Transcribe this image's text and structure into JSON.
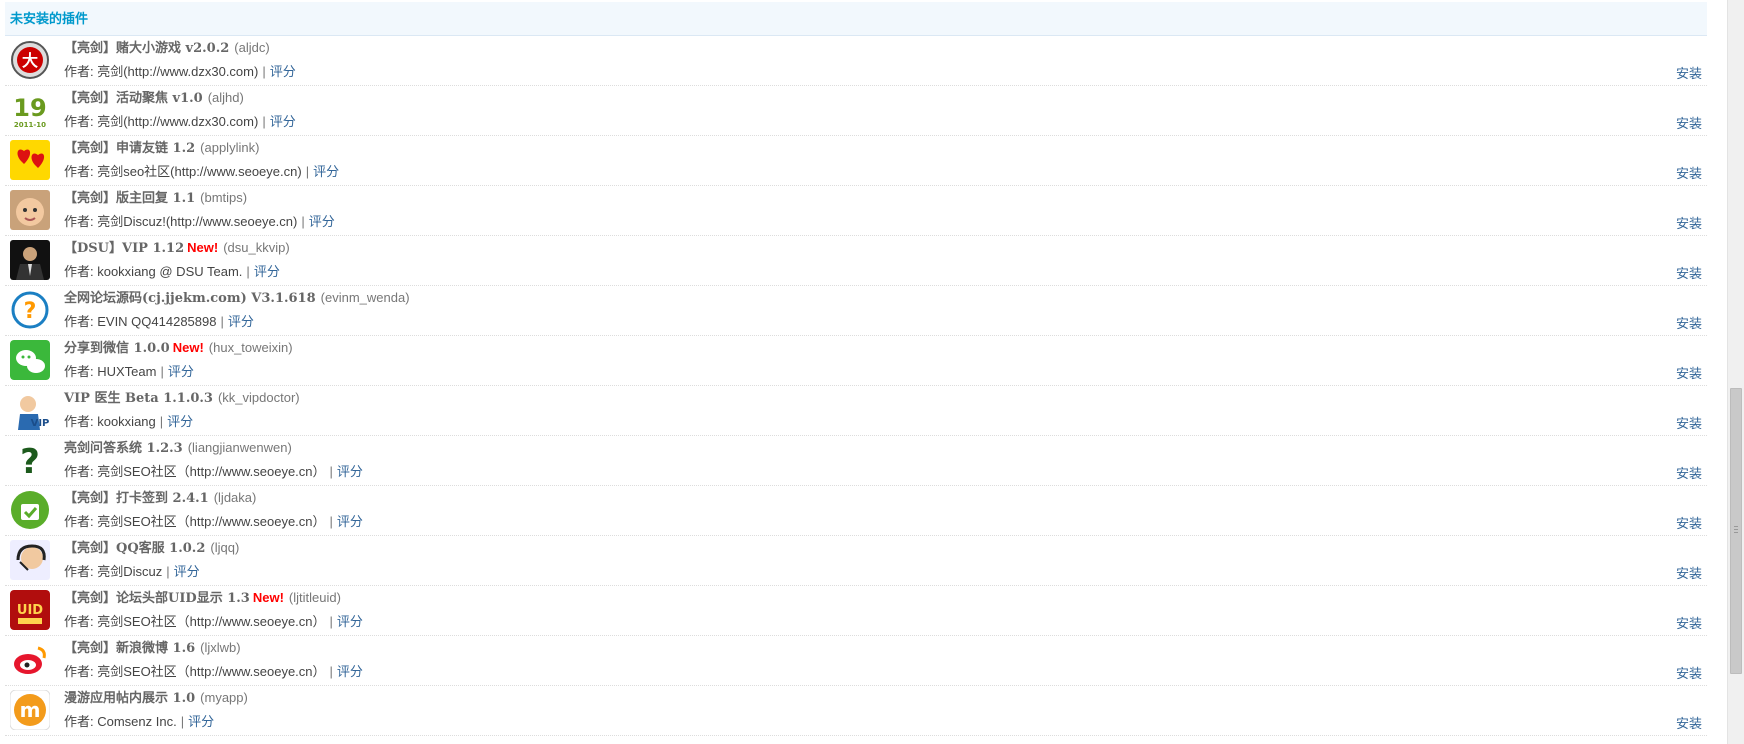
{
  "section": {
    "title": "未安装的插件"
  },
  "colors": {
    "link": "#336699",
    "header_text": "#0099cc",
    "new_badge": "#ff0000"
  },
  "plugins": [
    {
      "icon": "dice-da-icon",
      "name": "【亮剑】赌大小游戏 v2.0.2",
      "new": "",
      "id": "(aljdc)",
      "author": "作者: 亮剑(http://www.dzx30.com)",
      "rate": "评分",
      "install": "安装"
    },
    {
      "icon": "calendar-19-icon",
      "name": "【亮剑】活动聚焦 v1.0",
      "new": "",
      "id": "(aljhd)",
      "author": "作者: 亮剑(http://www.dzx30.com)",
      "rate": "评分",
      "install": "安装"
    },
    {
      "icon": "hearts-icon",
      "name": "【亮剑】申请友链 1.2",
      "new": "",
      "id": "(applylink)",
      "author": "作者: 亮剑seo社区(http://www.seoeye.cn)",
      "rate": "评分",
      "install": "安装"
    },
    {
      "icon": "baby-face-icon",
      "name": "【亮剑】版主回复 1.1",
      "new": "",
      "id": "(bmtips)",
      "author": "作者: 亮剑Discuz!(http://www.seoeye.cn)",
      "rate": "评分",
      "install": "安装"
    },
    {
      "icon": "businessman-icon",
      "name": "【DSU】VIP 1.12",
      "new": "New!",
      "id": "(dsu_kkvip)",
      "author": "作者: kookxiang @ DSU Team.",
      "rate": "评分",
      "install": "安装"
    },
    {
      "icon": "question-circle-icon",
      "name": "全网论坛源码(cj.jjekm.com) V3.1.618",
      "new": "",
      "id": "(evinm_wenda)",
      "author": "作者: EVIN QQ414285898",
      "rate": "评分",
      "install": "安装"
    },
    {
      "icon": "wechat-icon",
      "name": "分享到微信 1.0.0",
      "new": "New!",
      "id": "(hux_toweixin)",
      "author": "作者: HUXTeam",
      "rate": "评分",
      "install": "安装"
    },
    {
      "icon": "vip-doctor-icon",
      "name": "VIP 医生 Beta 1.1.0.3",
      "new": "",
      "id": "(kk_vipdoctor)",
      "author": "作者: kookxiang",
      "rate": "评分",
      "install": "安装"
    },
    {
      "icon": "question-mark-icon",
      "name": "亮剑问答系统 1.2.3",
      "new": "",
      "id": "(liangjianwenwen)",
      "author": "作者: 亮剑SEO社区（http://www.seoeye.cn）",
      "rate": "评分",
      "install": "安装"
    },
    {
      "icon": "checkin-bag-icon",
      "name": "【亮剑】打卡签到 2.4.1",
      "new": "",
      "id": "(ljdaka)",
      "author": "作者: 亮剑SEO社区（http://www.seoeye.cn）",
      "rate": "评分",
      "install": "安装"
    },
    {
      "icon": "headset-service-icon",
      "name": "【亮剑】QQ客服 1.0.2",
      "new": "",
      "id": "(ljqq)",
      "author": "作者: 亮剑Discuz",
      "rate": "评分",
      "install": "安装"
    },
    {
      "icon": "uid-badge-icon",
      "name": "【亮剑】论坛头部UID显示 1.3",
      "new": "New!",
      "id": "(ljtitleuid)",
      "author": "作者: 亮剑SEO社区（http://www.seoeye.cn）",
      "rate": "评分",
      "install": "安装"
    },
    {
      "icon": "weibo-icon",
      "name": "【亮剑】新浪微博 1.6",
      "new": "",
      "id": "(ljxlwb)",
      "author": "作者: 亮剑SEO社区（http://www.seoeye.cn）",
      "rate": "评分",
      "install": "安装"
    },
    {
      "icon": "myapp-m-icon",
      "name": "漫游应用帖内展示 1.0",
      "new": "",
      "id": "(myapp)",
      "author": "作者: Comsenz Inc.",
      "rate": "评分",
      "install": "安装"
    }
  ]
}
